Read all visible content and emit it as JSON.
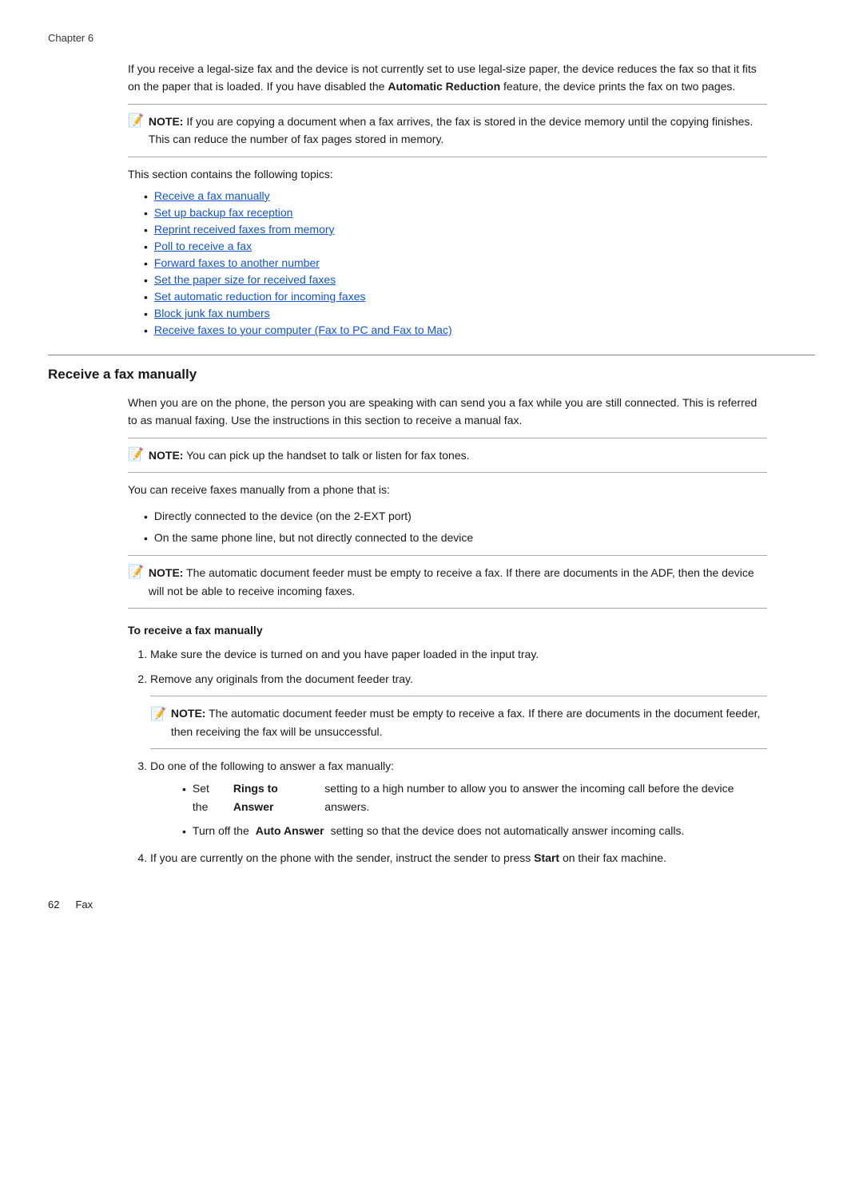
{
  "chapter_label": "Chapter 6",
  "intro": {
    "para1": "If you receive a legal-size fax and the device is not currently set to use legal-size paper, the device reduces the fax so that it fits on the paper that is loaded. If you have disabled the Automatic Reduction feature, the device prints the fax on two pages.",
    "para1_bold": "Automatic Reduction",
    "note1_label": "NOTE:",
    "note1_text": "If you are copying a document when a fax arrives, the fax is stored in the device memory until the copying finishes. This can reduce the number of fax pages stored in memory."
  },
  "topics": {
    "intro": "This section contains the following topics:",
    "items": [
      "Receive a fax manually",
      "Set up backup fax reception",
      "Reprint received faxes from memory",
      "Poll to receive a fax",
      "Forward faxes to another number",
      "Set the paper size for received faxes",
      "Set automatic reduction for incoming faxes",
      "Block junk fax numbers",
      "Receive faxes to your computer (Fax to PC and Fax to Mac)"
    ]
  },
  "receive_section": {
    "heading": "Receive a fax manually",
    "para1": "When you are on the phone, the person you are speaking with can send you a fax while you are still connected. This is referred to as manual faxing. Use the instructions in this section to receive a manual fax.",
    "note2_label": "NOTE:",
    "note2_text": "You can pick up the handset to talk or listen for fax tones.",
    "receive_from_intro": "You can receive faxes manually from a phone that is:",
    "receive_from_list": [
      "Directly connected to the device (on the 2-EXT port)",
      "On the same phone line, but not directly connected to the device"
    ],
    "note3_label": "NOTE:",
    "note3_text": "The automatic document feeder must be empty to receive a fax. If there are documents in the ADF, then the device will not be able to receive incoming faxes.",
    "to_receive_heading": "To receive a fax manually",
    "steps": [
      "Make sure the device is turned on and you have paper loaded in the input tray.",
      "Remove any originals from the document feeder tray."
    ],
    "step2_note_label": "NOTE:",
    "step2_note_text": "The automatic document feeder must be empty to receive a fax. If there are documents in the document feeder, then receiving the fax will be unsuccessful.",
    "step3_label": "Do one of the following to answer a fax manually:",
    "step3_bullets": [
      {
        "text_before": "Set the ",
        "bold": "Rings to Answer",
        "text_after": " setting to a high number to allow you to answer the incoming call before the device answers."
      },
      {
        "text_before": "Turn off the ",
        "bold": "Auto Answer",
        "text_after": " setting so that the device does not automatically answer incoming calls."
      }
    ],
    "step4_text_before": "If you are currently on the phone with the sender, instruct the sender to press ",
    "step4_bold": "Start",
    "step4_text_after": " on their fax machine."
  },
  "footer": {
    "page": "62",
    "label": "Fax"
  }
}
